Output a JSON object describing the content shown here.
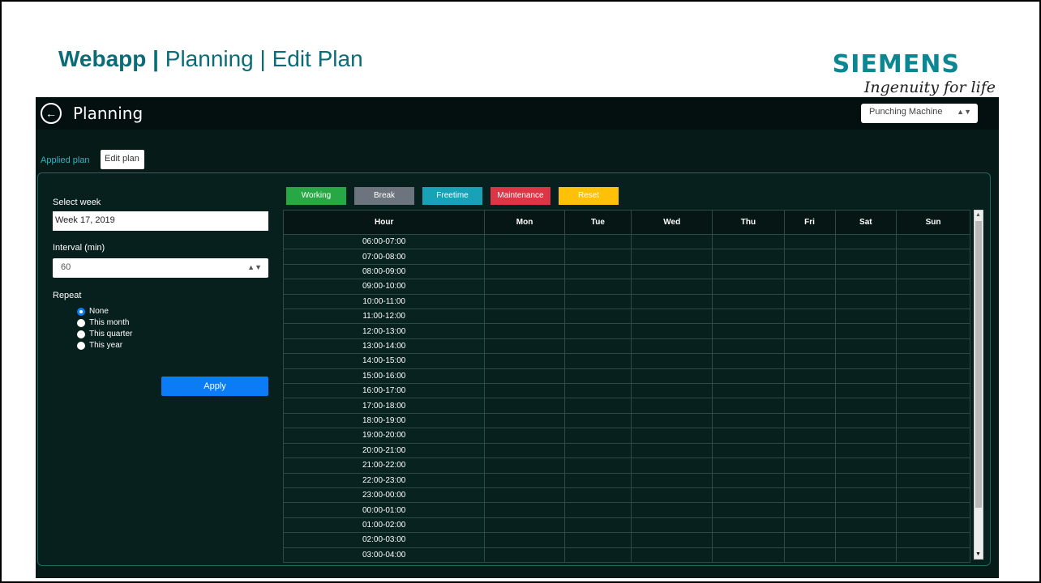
{
  "slide": {
    "title_bold": "Webapp |",
    "title_rest": " Planning | Edit Plan",
    "brand_name": "SIEMENS",
    "brand_tagline": "Ingenuity for life"
  },
  "header": {
    "title": "Planning",
    "back_icon": "arrow-left-circle-icon",
    "machine_select": "Punching Machine"
  },
  "tabs": {
    "applied": "Applied plan",
    "edit": "Edit plan"
  },
  "form": {
    "week_label": "Select week",
    "week_value": "Week 17, 2019",
    "interval_label": "Interval (min)",
    "interval_value": "60",
    "repeat_label": "Repeat",
    "repeat_options": [
      {
        "label": "None",
        "checked": true
      },
      {
        "label": "This month",
        "checked": false
      },
      {
        "label": "This quarter",
        "checked": false
      },
      {
        "label": "This year",
        "checked": false
      }
    ],
    "apply_label": "Apply"
  },
  "legend": [
    {
      "label": "Working",
      "color": "#28a745"
    },
    {
      "label": "Break",
      "color": "#6c757d"
    },
    {
      "label": "Freetime",
      "color": "#17a2b8"
    },
    {
      "label": "Maintenance",
      "color": "#dc3545"
    },
    {
      "label": "Reset",
      "color": "#ffc107"
    }
  ],
  "table": {
    "columns": [
      "Hour",
      "Mon",
      "Tue",
      "Wed",
      "Thu",
      "Fri",
      "Sat",
      "Sun"
    ],
    "hours": [
      "06:00-07:00",
      "07:00-08:00",
      "08:00-09:00",
      "09:00-10:00",
      "10:00-11:00",
      "11:00-12:00",
      "12:00-13:00",
      "13:00-14:00",
      "14:00-15:00",
      "15:00-16:00",
      "16:00-17:00",
      "17:00-18:00",
      "18:00-19:00",
      "19:00-20:00",
      "20:00-21:00",
      "21:00-22:00",
      "22:00-23:00",
      "23:00-00:00",
      "00:00-01:00",
      "01:00-02:00",
      "02:00-03:00",
      "03:00-04:00"
    ]
  }
}
